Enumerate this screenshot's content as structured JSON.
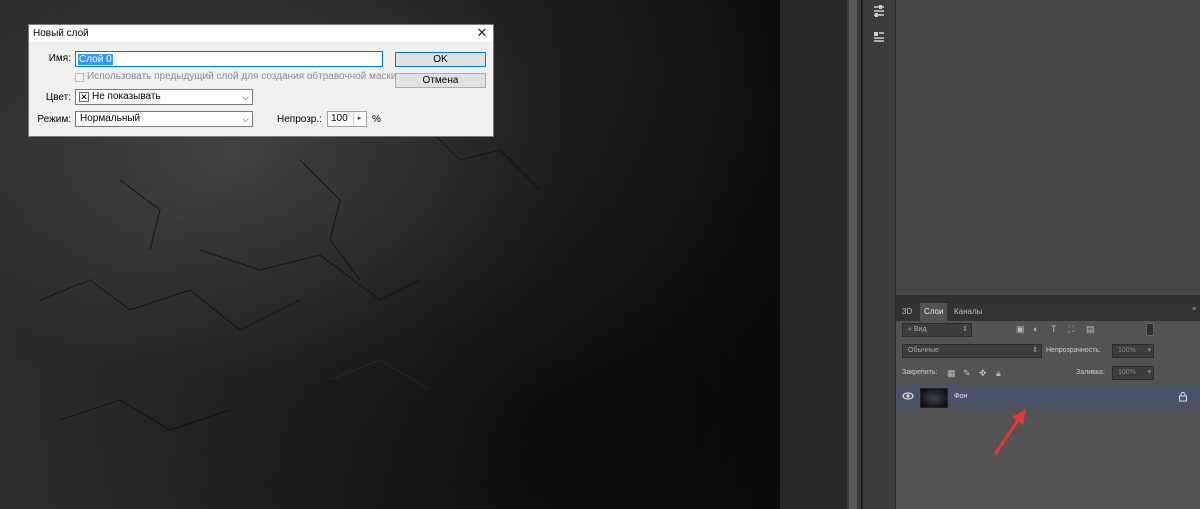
{
  "dialog": {
    "title": "Новый слой",
    "close_glyph": "✕",
    "name_label": "Имя:",
    "name_value": "Слой 0",
    "checkbox_label": "Использовать предыдущий слой для создания обтравочной маски",
    "color_label": "Цвет:",
    "color_value": "Не показывать",
    "mode_label": "Режим:",
    "mode_value": "Нормальный",
    "opacity_label": "Непрозр.:",
    "opacity_value": "100",
    "opacity_unit": "%",
    "ok_label": "OK",
    "cancel_label": "Отмена"
  },
  "layers_panel": {
    "tabs": [
      "3D",
      "Слои",
      "Каналы"
    ],
    "active_tab": "Слои",
    "filter_kind": "Вид",
    "blend_mode": "Обычные",
    "opacity_label": "Непрозрачность:",
    "opacity_value": "100%",
    "lock_label": "Закрепить:",
    "fill_label": "Заливка:",
    "fill_value": "100%",
    "layers": [
      {
        "name": "Фон",
        "visible": true,
        "locked": true
      }
    ]
  },
  "colors": {
    "accent": "#0078d7",
    "selected_layer": "#49536a",
    "arrow": "#e53a2b"
  }
}
